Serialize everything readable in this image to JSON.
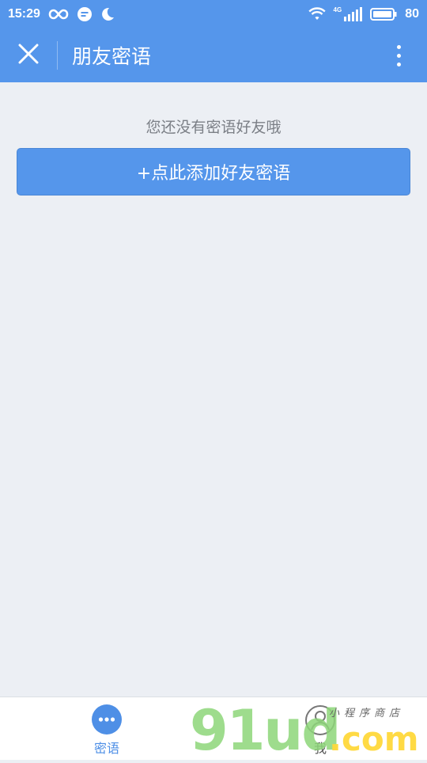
{
  "status_bar": {
    "time": "15:29",
    "network_type": "4G",
    "battery": "80",
    "icons": [
      "infinity-icon",
      "chat-bubble-icon",
      "moon-icon",
      "wifi-icon",
      "signal-icon",
      "battery-icon"
    ]
  },
  "header": {
    "title": "朋友密语",
    "close_icon": "close-icon",
    "more_icon": "more-vertical-icon"
  },
  "main": {
    "empty_message": "您还没有密语好友哦",
    "add_button_label": "+点此添加好友密语"
  },
  "tab_bar": {
    "tabs": [
      {
        "label": "密语",
        "icon": "chat-dots-icon",
        "active": true
      },
      {
        "label": "我",
        "icon": "user-icon",
        "active": false
      }
    ]
  },
  "watermark": {
    "text": "91ud",
    "suffix": ".com",
    "subtitle": "小程序商店"
  },
  "colors": {
    "primary": "#5596eb",
    "background": "#eceff4",
    "muted_text": "#7b7f86"
  }
}
